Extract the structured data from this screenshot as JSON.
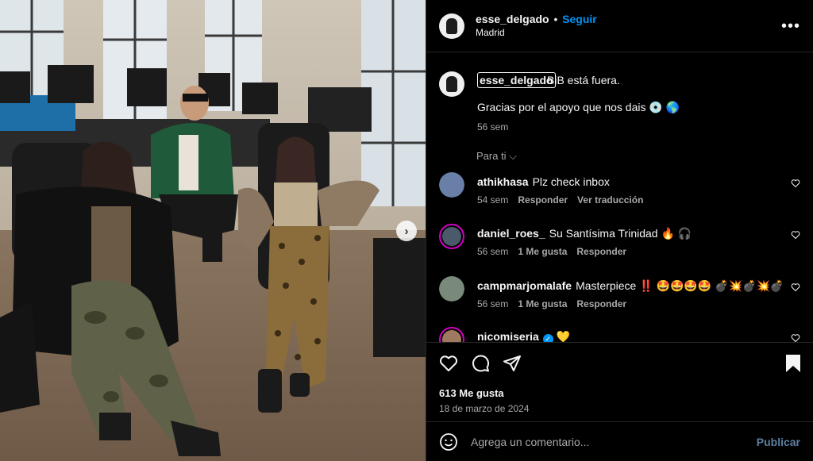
{
  "post": {
    "username": "esse_delgado",
    "separator": "•",
    "follow_label": "Seguir",
    "location": "Madrid",
    "more_label": "•••"
  },
  "caption": {
    "username": "esse_delgado",
    "line1": "BiB está fuera.",
    "line2": "Gracias por el apoyo que nos dais 💿 🌎",
    "time": "56 sem"
  },
  "para_ti_label": "Para ti ⌵",
  "comments": [
    {
      "user": "athikhasa",
      "text": "Plz check inbox",
      "time": "54 sem",
      "likes": "",
      "reply": "Responder",
      "translate": "Ver traducción",
      "avatar_color": "#6a7fa8"
    },
    {
      "user": "daniel_roes_",
      "text": "Su Santísima Trinidad 🔥 🎧",
      "time": "56 sem",
      "likes": "1 Me gusta",
      "reply": "Responder",
      "translate": "",
      "avatar_color": "#4a5a6a"
    },
    {
      "user": "campmarjomalafe",
      "text": "Masterpiece ‼️ 🤩🤩🤩🤩 💣💥💣💥💣",
      "time": "56 sem",
      "likes": "1 Me gusta",
      "reply": "Responder",
      "translate": "",
      "avatar_color": "#7a8a7a"
    },
    {
      "user": "nicomiseria",
      "text": "💛",
      "verified": "✓",
      "time": "",
      "likes": "",
      "reply": "",
      "translate": "",
      "avatar_color": "#a07a60"
    }
  ],
  "likes_count": "613 Me gusta",
  "post_date": "18 de marzo de 2024",
  "add_comment": {
    "placeholder": "Agrega un comentario...",
    "publish_label": "Publicar"
  },
  "carousel_next": "›",
  "colors": {
    "accent": "#0095f6",
    "background": "#000000",
    "muted": "#a8a8a8"
  }
}
